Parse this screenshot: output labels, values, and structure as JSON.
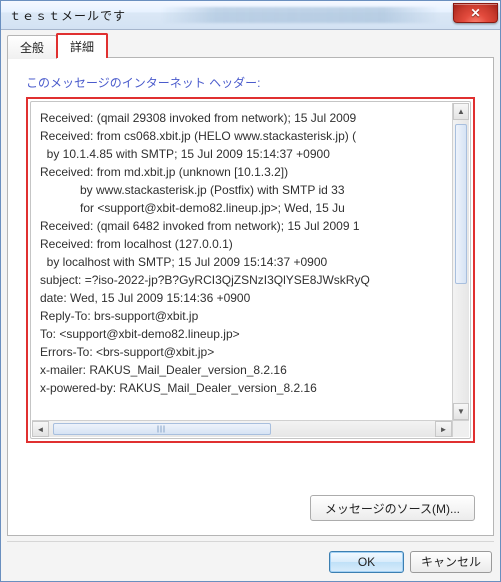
{
  "window": {
    "title": "ｔｅｓｔメールです"
  },
  "tabs": {
    "general": "全般",
    "details": "詳細"
  },
  "panel": {
    "label": "このメッセージのインターネット ヘッダー:"
  },
  "headers": {
    "lines": [
      "Received: (qmail 29308 invoked from network); 15 Jul 2009",
      "Received: from cs068.xbit.jp (HELO www.stackasterisk.jp) (",
      "  by 10.1.4.85 with SMTP; 15 Jul 2009 15:14:37 +0900",
      "Received: from md.xbit.jp (unknown [10.1.3.2])",
      "            by www.stackasterisk.jp (Postfix) with SMTP id 33",
      "            for <support@xbit-demo82.lineup.jp>; Wed, 15 Ju",
      "Received: (qmail 6482 invoked from network); 15 Jul 2009 1",
      "Received: from localhost (127.0.0.1)",
      "  by localhost with SMTP; 15 Jul 2009 15:14:37 +0900",
      "subject: =?iso-2022-jp?B?GyRCI3QjZSNzI3QlYSE8JWskRyQ",
      "date: Wed, 15 Jul 2009 15:14:36 +0900",
      "Reply-To: brs-support@xbit.jp",
      "To: <support@xbit-demo82.lineup.jp>",
      "Errors-To: <brs-support@xbit.jp>",
      "x-mailer: RAKUS_Mail_Dealer_version_8.2.16",
      "x-powered-by: RAKUS_Mail_Dealer_version_8.2.16"
    ]
  },
  "buttons": {
    "source": "メッセージのソース(M)...",
    "ok": "OK",
    "cancel": "キャンセル"
  },
  "colors": {
    "highlight_border": "#e03030",
    "title_link": "#4a5bcc"
  }
}
